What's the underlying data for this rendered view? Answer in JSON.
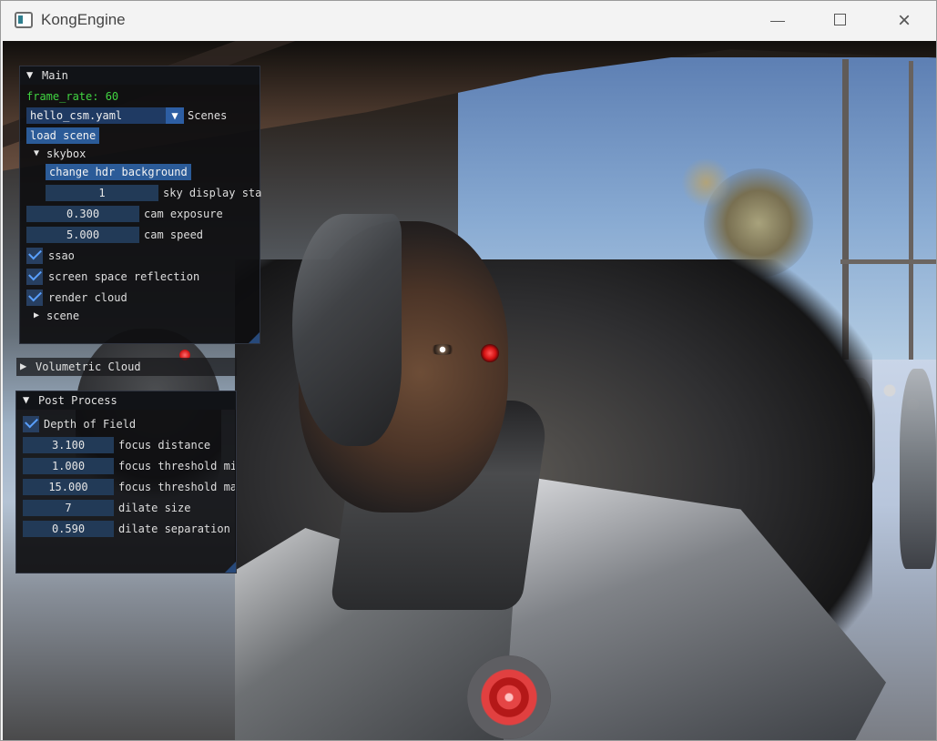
{
  "window": {
    "title": "KongEngine",
    "controls": {
      "minimize": "—",
      "maximize": "□",
      "close": "×"
    }
  },
  "main_panel": {
    "title": "Main",
    "arrow": "▼",
    "frame_rate": "frame_rate: 60",
    "scene_select": {
      "value": "hello_csm.yaml",
      "label": "Scenes",
      "arrow": "▼"
    },
    "load_scene": "load scene",
    "skybox": {
      "arrow": "▼",
      "label": "skybox",
      "change_background": "change hdr background",
      "sky_display_value": "1",
      "sky_display_label": "sky display sta"
    },
    "cam_exposure": {
      "value": "0.300",
      "label": "cam exposure"
    },
    "cam_speed": {
      "value": "5.000",
      "label": "cam speed"
    },
    "checkboxes": [
      {
        "label": "ssao",
        "checked": true
      },
      {
        "label": "screen space reflection",
        "checked": true
      },
      {
        "label": "render cloud",
        "checked": true
      }
    ],
    "scene": {
      "arrow": "▶",
      "label": "scene"
    }
  },
  "volumetric_panel": {
    "arrow": "▶",
    "title": "Volumetric Cloud"
  },
  "post_panel": {
    "title": "Post Process",
    "arrow": "▼",
    "depth_of_field": {
      "label": "Depth of Field",
      "checked": true
    },
    "fields": [
      {
        "value": "3.100",
        "label": "focus distance"
      },
      {
        "value": "1.000",
        "label": "focus threshold min"
      },
      {
        "value": "15.000",
        "label": "focus threshold max"
      },
      {
        "value": "7",
        "label": "dilate size"
      },
      {
        "value": "0.590",
        "label": "dilate separation"
      }
    ]
  }
}
